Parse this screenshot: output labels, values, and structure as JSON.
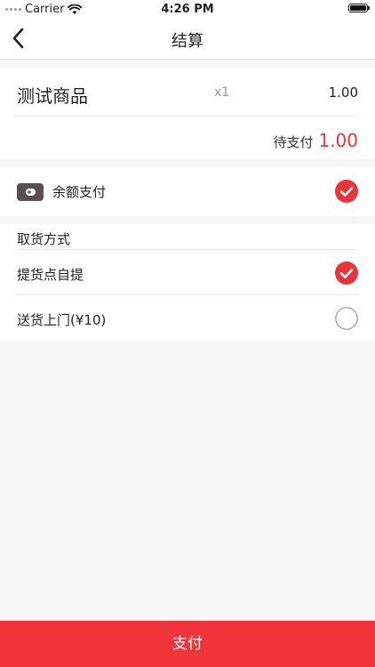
{
  "status_bar": {
    "carrier": "Carrier",
    "time": "4:26 PM"
  },
  "nav": {
    "title": "结算",
    "back_icon": "chevron-left-icon"
  },
  "product": {
    "name": "测试商品",
    "quantity": "x1",
    "price": "1.00",
    "pending_label": "待支付",
    "pending_amount": "1.00"
  },
  "payment": {
    "label": "余额支付",
    "icon": "wallet-icon",
    "selected": true
  },
  "pickup": {
    "title": "取货方式",
    "options": [
      {
        "label": "提货点自提",
        "selected": true
      },
      {
        "label": "送货上门(¥10)",
        "selected": false
      }
    ]
  },
  "footer": {
    "pay_label": "支付"
  },
  "colors": {
    "accent": "#e8353a",
    "pay_button": "#f0363a",
    "background": "#f6f6f6"
  }
}
